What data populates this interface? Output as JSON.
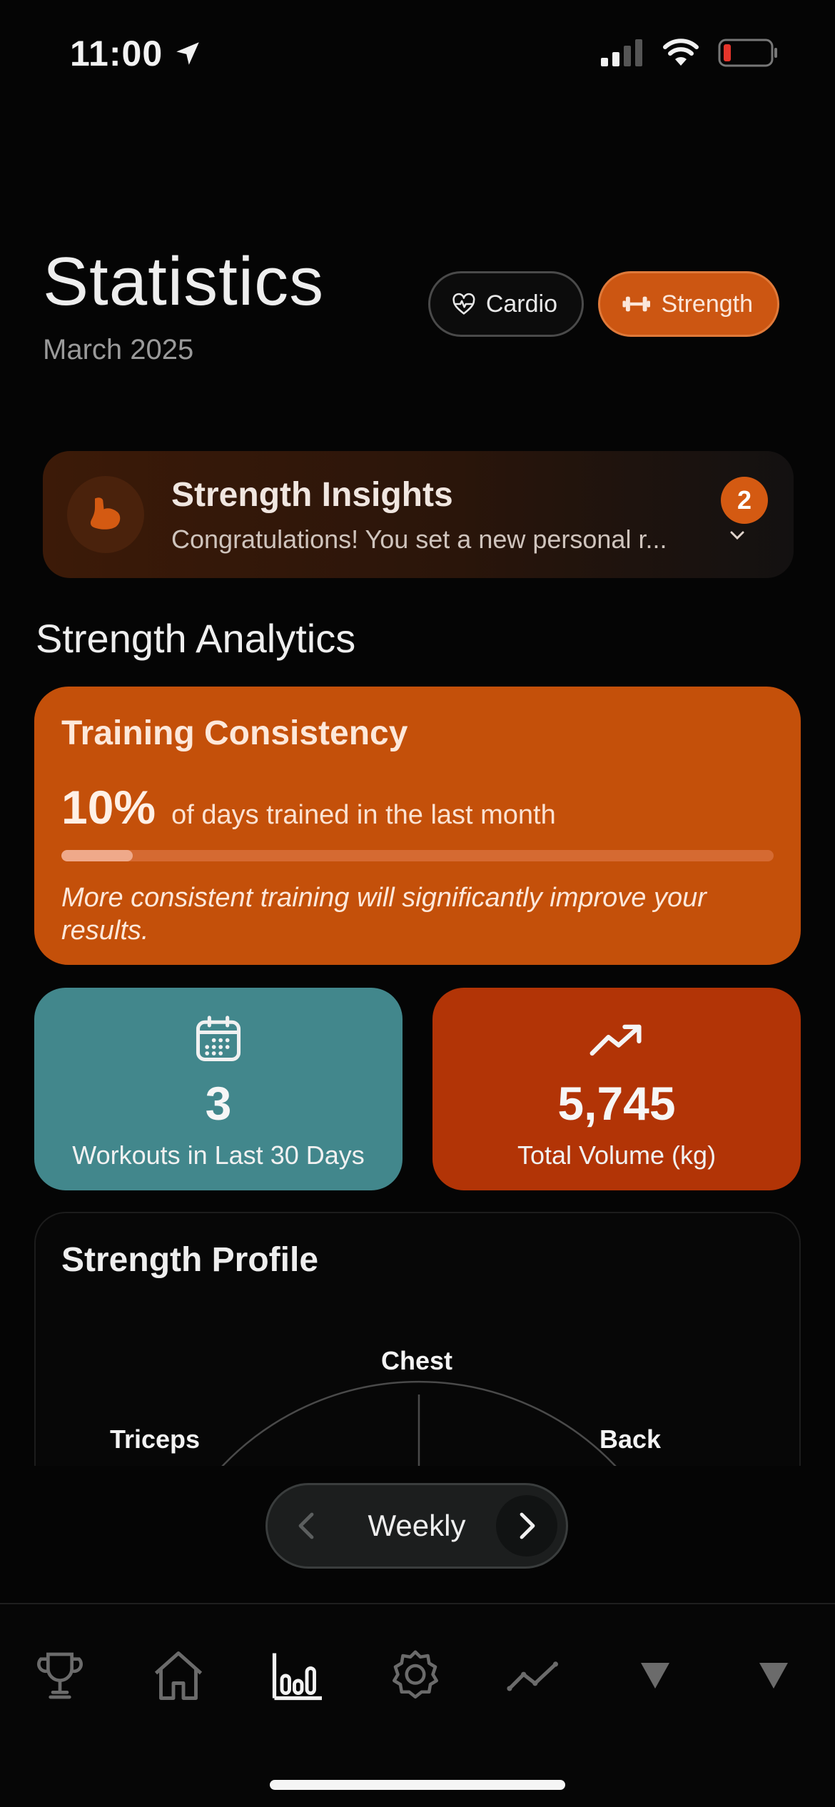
{
  "status_bar": {
    "time": "11:00"
  },
  "header": {
    "title": "Statistics",
    "subtitle": "March 2025"
  },
  "mode_toggle": {
    "cardio_label": "Cardio",
    "strength_label": "Strength",
    "selected": "Strength"
  },
  "insights": {
    "title": "Strength Insights",
    "body": "Congratulations! You set a new personal r...",
    "badge_count": "2"
  },
  "section_title": "Strength Analytics",
  "consistency": {
    "title": "Training Consistency",
    "percent": "10%",
    "percent_value": 0.1,
    "label": "of days trained in the last month",
    "note": "More consistent training will significantly improve your results."
  },
  "stats": {
    "workouts_value": "3",
    "workouts_label": "Workouts in Last 30 Days",
    "volume_value": "5,745",
    "volume_label": "Total Volume (kg)"
  },
  "profile": {
    "title": "Strength Profile",
    "axes": {
      "top": "Chest",
      "left": "Triceps",
      "right": "Back"
    }
  },
  "period": {
    "label": "Weekly"
  },
  "tabs": [
    {
      "name": "trophy-icon",
      "active": false
    },
    {
      "name": "home-icon",
      "active": false
    },
    {
      "name": "bar-chart-icon",
      "active": true
    },
    {
      "name": "gear-icon",
      "active": false
    },
    {
      "name": "trend-line-icon",
      "active": false
    },
    {
      "name": "triangle-down-icon",
      "active": false
    },
    {
      "name": "triangle-down-icon",
      "active": false
    }
  ],
  "colors": {
    "accent": "#cc5612",
    "consistency_card": "#c4500a",
    "workouts_card": "#42878c",
    "volume_card": "#b23406"
  }
}
